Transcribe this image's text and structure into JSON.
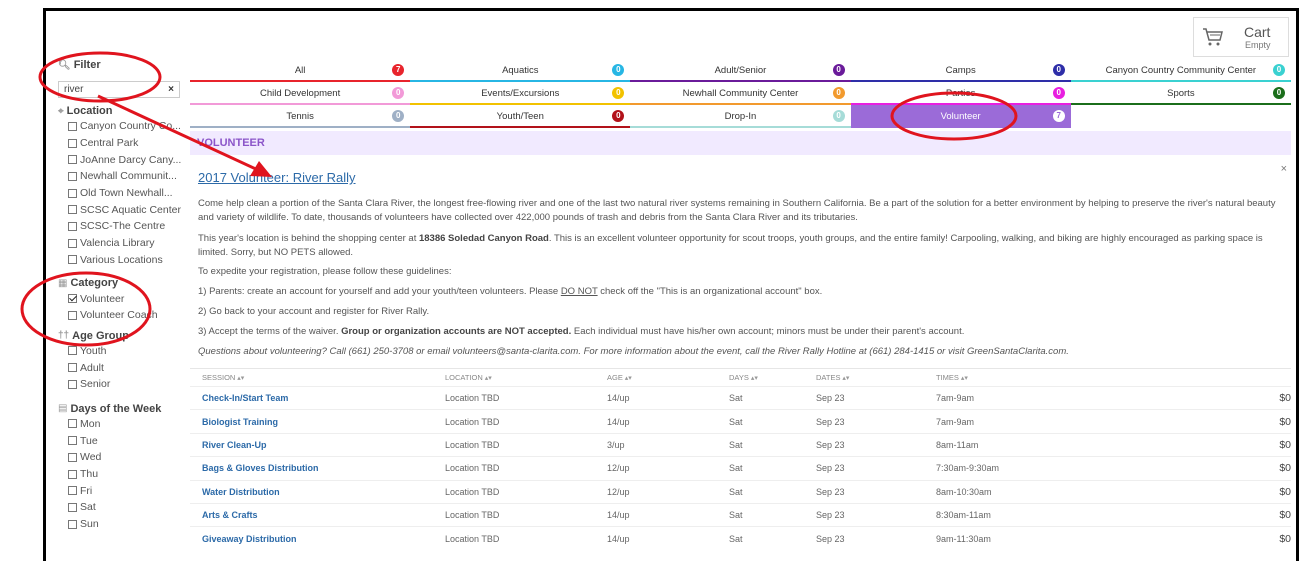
{
  "cart": {
    "label": "Cart",
    "status": "Empty",
    "icon": "cart-icon"
  },
  "sidebar": {
    "filter_title": "Filter",
    "filter_value": "river",
    "clear_label": "×",
    "location_title": "Location",
    "locations": [
      "Canyon Country Co...",
      "Central Park",
      "JoAnne Darcy Cany...",
      "Newhall Communit...",
      "Old Town Newhall...",
      "SCSC Aquatic Center",
      "SCSC-The Centre",
      "Valencia Library",
      "Various Locations"
    ],
    "category_title": "Category",
    "categories": [
      {
        "label": "Volunteer",
        "checked": true
      },
      {
        "label": "Volunteer Coach",
        "checked": false
      }
    ],
    "age_title": "Age Group",
    "ages": [
      "Youth",
      "Adult",
      "Senior"
    ],
    "days_title": "Days of the Week",
    "days": [
      "Mon",
      "Tue",
      "Wed",
      "Thu",
      "Fri",
      "Sat",
      "Sun"
    ]
  },
  "tabs": [
    [
      {
        "label": "All",
        "count": "7",
        "color": "#e8242c"
      },
      {
        "label": "Aquatics",
        "count": "0",
        "color": "#27b6e4"
      },
      {
        "label": "Adult/Senior",
        "count": "0",
        "color": "#6a1b9a"
      },
      {
        "label": "Camps",
        "count": "0",
        "color": "#2e2ea8"
      },
      {
        "label": "Canyon Country Community Center",
        "count": "0",
        "color": "#3ad1d1"
      }
    ],
    [
      {
        "label": "Child Development",
        "count": "0",
        "color": "#f29ad8"
      },
      {
        "label": "Events/Excursions",
        "count": "0",
        "color": "#f2c200"
      },
      {
        "label": "Newhall Community Center",
        "count": "0",
        "color": "#f29a2e"
      },
      {
        "label": "Parties",
        "count": "0",
        "color": "#e81fe0"
      },
      {
        "label": "Sports",
        "count": "0",
        "color": "#1b6e1b"
      }
    ],
    [
      {
        "label": "Tennis",
        "count": "0",
        "color": "#9fb0c6"
      },
      {
        "label": "Youth/Teen",
        "count": "0",
        "color": "#b2121a"
      },
      {
        "label": "Drop-In",
        "count": "0",
        "color": "#a6dcd8"
      },
      {
        "label": "Volunteer",
        "count": "7",
        "color": "#9b6bd8",
        "active": true
      }
    ]
  ],
  "section_header": "VOLUNTEER",
  "event": {
    "title": "2017 Volunteer: River Rally",
    "close": "×",
    "p1": "Come help clean a portion of the Santa Clara River, the longest free-flowing river and one of the last two natural river systems remaining in Southern California. Be a part of the solution for a better environment by helping to preserve the river's natural beauty and variety of wildlife. To date, thousands of volunteers have collected over 422,000 pounds of trash and debris from the Santa Clara River and its tributaries.",
    "p2_a": "This year's location is behind the shopping center at ",
    "p2_b": "18386 Soledad Canyon Road",
    "p2_c": ".  This is an excellent volunteer opportunity for scout troops, youth groups, and the entire family! Carpooling, walking, and biking are highly encouraged as parking space is limited. Sorry, but NO PETS allowed.",
    "p3": "To expedite your registration, please follow these guidelines:",
    "p4_a": "1) Parents: create an account for yourself and add your youth/teen volunteers. Please ",
    "p4_b": "DO NOT",
    "p4_c": " check off the \"This is an organizational account\" box.",
    "p5": "2) Go back to your account and register for River Rally.",
    "p6_a": "3) Accept the terms of the waiver. ",
    "p6_b": "Group or organization accounts are NOT accepted.",
    "p6_c": "  Each individual must have his/her own account; minors must be under their parent's account.",
    "p7": "Questions about volunteering? Call (661) 250-3708 or email volunteers@santa-clarita.com. For more information about the event, call the River Rally Hotline at (661) 284-1415 or visit GreenSantaClarita.com."
  },
  "table": {
    "headers": [
      "SESSION",
      "LOCATION",
      "AGE",
      "DAYS",
      "DATES",
      "TIMES"
    ],
    "rows": [
      [
        "Check-In/Start Team",
        "Location TBD",
        "14/up",
        "Sat",
        "Sep 23",
        "7am-9am",
        "$0"
      ],
      [
        "Biologist Training",
        "Location TBD",
        "14/up",
        "Sat",
        "Sep 23",
        "7am-9am",
        "$0"
      ],
      [
        "River Clean-Up",
        "Location TBD",
        "3/up",
        "Sat",
        "Sep 23",
        "8am-11am",
        "$0"
      ],
      [
        "Bags & Gloves Distribution",
        "Location TBD",
        "12/up",
        "Sat",
        "Sep 23",
        "7:30am-9:30am",
        "$0"
      ],
      [
        "Water Distribution",
        "Location TBD",
        "12/up",
        "Sat",
        "Sep 23",
        "8am-10:30am",
        "$0"
      ],
      [
        "Arts & Crafts",
        "Location TBD",
        "14/up",
        "Sat",
        "Sep 23",
        "8:30am-11am",
        "$0"
      ],
      [
        "Giveaway Distribution",
        "Location TBD",
        "14/up",
        "Sat",
        "Sep 23",
        "9am-11:30am",
        "$0"
      ]
    ]
  },
  "colors": {
    "accent": "#9b6bd8",
    "link": "#2c6aa8",
    "annotation": "#e0141e"
  }
}
